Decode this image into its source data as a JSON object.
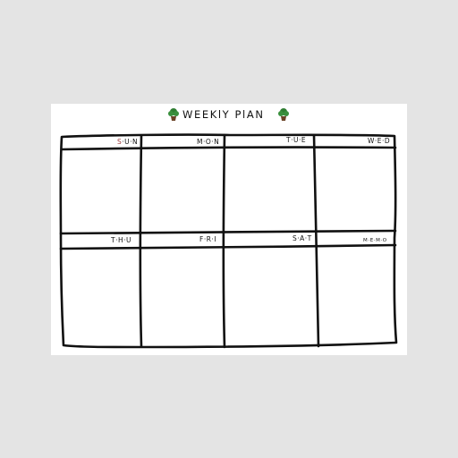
{
  "colors": {
    "background": "#e4e4e4",
    "sheet": "#ffffff",
    "ink": "#111111",
    "accent_letter": "#9c3a3a",
    "plant_leaf": "#2f7d32",
    "plant_pot": "#6b4226"
  },
  "title": {
    "text": "WEEKlY PlAN",
    "left_icon": "potted-plant-icon",
    "right_icon": "potted-plant-icon"
  },
  "days": {
    "sun": {
      "first": "S",
      "rest": "·U·N"
    },
    "mon": "M·O·N",
    "tue": "T·U·E",
    "wed": "W·E·D",
    "thu": "T·H·U",
    "fri": "F·R·I",
    "sat": "S·A·T",
    "memo": "M·E·M·O"
  }
}
